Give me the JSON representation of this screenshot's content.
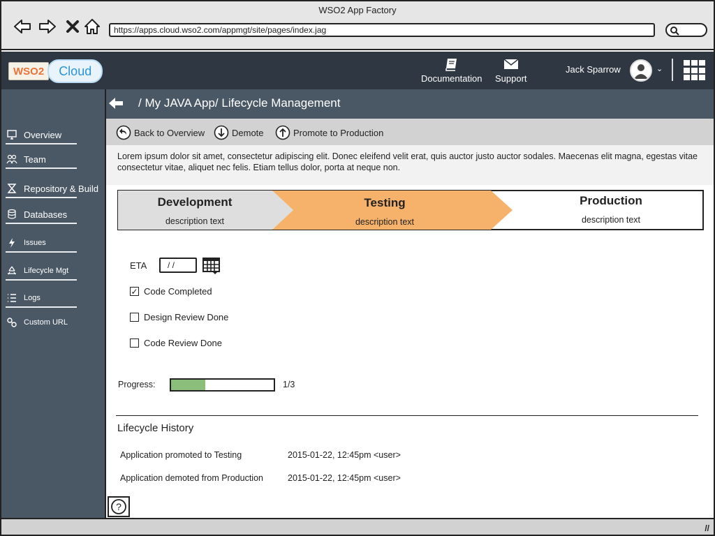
{
  "browser": {
    "title": "WSO2 App Factory",
    "url": "https://apps.cloud.wso2.com/appmgt/site/pages/index.jag"
  },
  "header": {
    "logo_wso2": "WSO2",
    "logo_cloud": "Cloud",
    "documentation_label": "Documentation",
    "support_label": "Support",
    "user_name": "Jack Sparrow"
  },
  "sidebar": {
    "items": [
      {
        "label": "Overview",
        "icon": "monitor-icon"
      },
      {
        "label": "Team",
        "icon": "team-icon"
      },
      {
        "label": "Repository & Build",
        "icon": "hourglass-icon"
      },
      {
        "label": "Databases",
        "icon": "database-icon"
      },
      {
        "label": "Issues",
        "icon": "bolt-icon"
      },
      {
        "label": "Lifecycle Mgt",
        "icon": "recycle-icon"
      },
      {
        "label": "Logs",
        "icon": "list-icon"
      },
      {
        "label": "Custom URL",
        "icon": "link-icon"
      }
    ]
  },
  "breadcrumb": "/ My JAVA App/ Lifecycle Management",
  "toolbar": {
    "back_label": "Back to Overview",
    "demote_label": "Demote",
    "promote_label": "Promote  to Production"
  },
  "description": "Lorem ipsum dolor sit amet, consectetur adipiscing elit. Donec eleifend velit erat, quis auctor justo auctor sodales. Maecenas elit magna, egestas vitae consectetur vitae, aliquet nec felis. Etiam tellus dolor, porta at neque non.",
  "stages": [
    {
      "name": "Development",
      "desc": "description text",
      "state": "done"
    },
    {
      "name": "Testing",
      "desc": "description text",
      "state": "current"
    },
    {
      "name": "Production",
      "desc": "description text",
      "state": "pending"
    }
  ],
  "colors": {
    "current_stage": "#f6b26b",
    "done_stage": "#dedede",
    "progress_fill": "#8bbd7b",
    "sidebar": "#4a5866",
    "header": "#2f3742"
  },
  "checklist": {
    "eta_label": "ETA",
    "eta_value": "/ /",
    "items": [
      {
        "label": "Code Completed",
        "checked": true
      },
      {
        "label": "Design Review Done",
        "checked": false
      },
      {
        "label": "Code Review Done",
        "checked": false
      }
    ]
  },
  "progress": {
    "label": "Progress:",
    "value": 0.333,
    "text": "1/3"
  },
  "history": {
    "title": "Lifecycle History",
    "rows": [
      {
        "event": "Application promoted to Testing",
        "time": "2015-01-22,  12:45pm <user>"
      },
      {
        "event": "Application demoted from Production",
        "time": "2015-01-22,  12:45pm <user>"
      }
    ]
  },
  "help_label": "?"
}
